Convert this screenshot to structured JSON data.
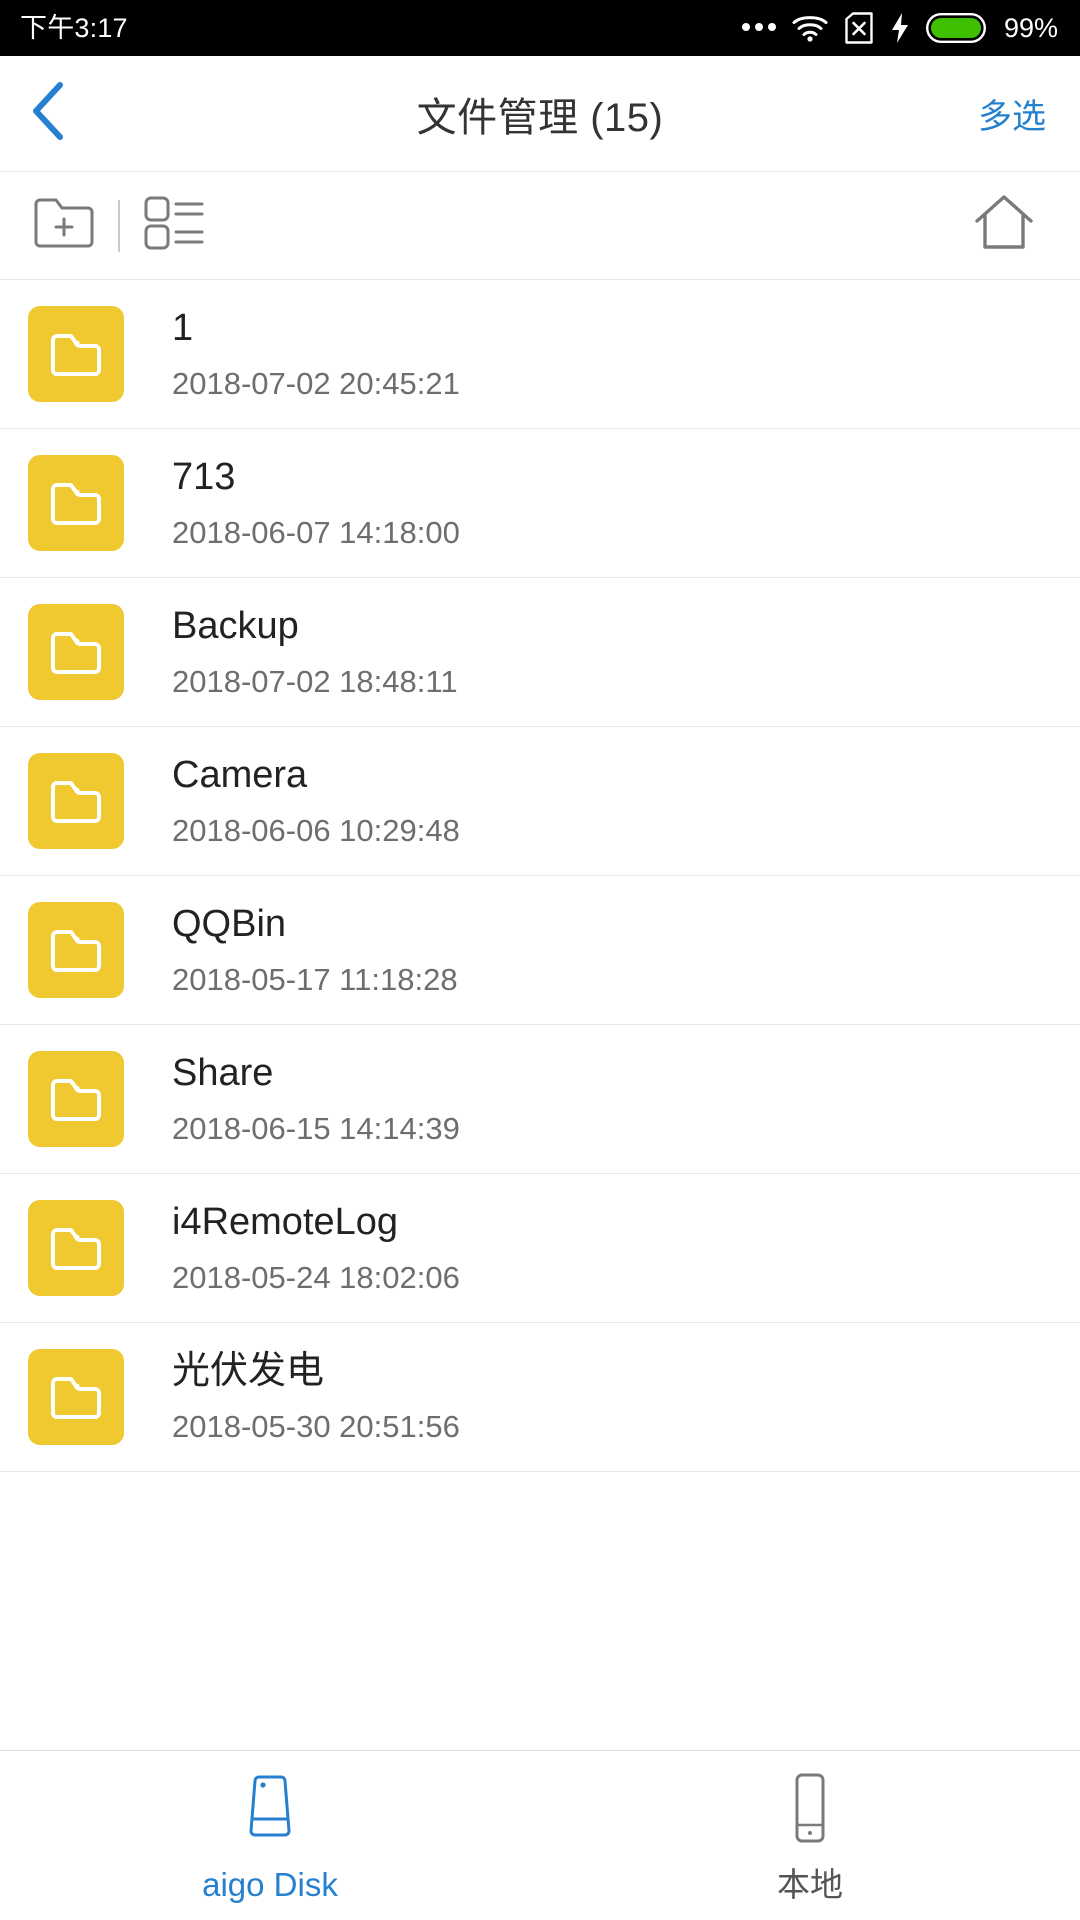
{
  "status_bar": {
    "time": "下午3:17",
    "battery_percent": "99%",
    "icons": [
      "more-dots-icon",
      "wifi-icon",
      "no-sim-icon",
      "charging-bolt-icon",
      "battery-icon"
    ],
    "battery_color": "#3fc000",
    "background": "#000000"
  },
  "title_bar": {
    "back_icon": "chevron-left-icon",
    "title": "文件管理 (15)",
    "action_label": "多选",
    "accent_color": "#2680d0"
  },
  "toolbar": {
    "new_folder_icon": "folder-plus-icon",
    "view_mode_icon": "list-view-icon",
    "home_icon": "home-icon",
    "icon_color": "#7a7a7a"
  },
  "file_list": {
    "folder_icon_color": "#f0c931",
    "items": [
      {
        "name": "1",
        "date": "2018-07-02 20:45:21",
        "icon": "folder-icon"
      },
      {
        "name": "713",
        "date": "2018-06-07 14:18:00",
        "icon": "folder-icon"
      },
      {
        "name": "Backup",
        "date": "2018-07-02 18:48:11",
        "icon": "folder-icon"
      },
      {
        "name": "Camera",
        "date": "2018-06-06 10:29:48",
        "icon": "folder-icon"
      },
      {
        "name": "QQBin",
        "date": "2018-05-17 11:18:28",
        "icon": "folder-icon"
      },
      {
        "name": "Share",
        "date": "2018-06-15 14:14:39",
        "icon": "folder-icon"
      },
      {
        "name": "i4RemoteLog",
        "date": "2018-05-24 18:02:06",
        "icon": "folder-icon"
      },
      {
        "name": "光伏发电",
        "date": "2018-05-30 20:51:56",
        "icon": "folder-icon"
      }
    ]
  },
  "tab_bar": {
    "tabs": [
      {
        "label": "aigo Disk",
        "icon": "external-disk-icon",
        "active": true
      },
      {
        "label": "本地",
        "icon": "phone-icon",
        "active": false
      }
    ],
    "active_color": "#2680d0",
    "inactive_color": "#555555"
  }
}
